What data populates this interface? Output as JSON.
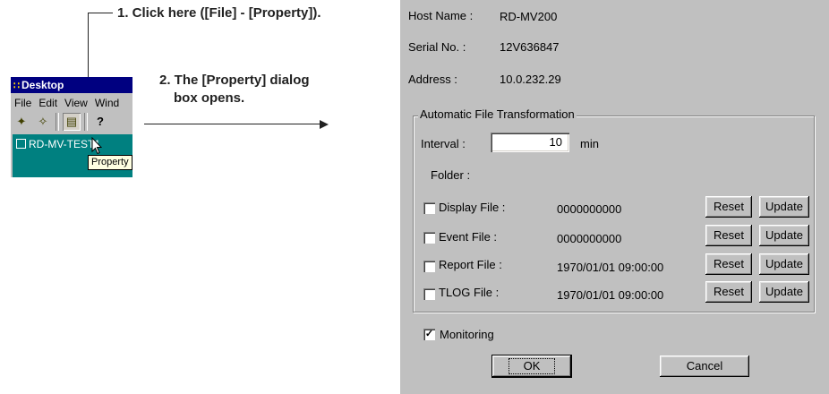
{
  "annotations": {
    "step1": "1. Click here ([File] - [Property]).",
    "step2_line1": "2. The [Property] dialog",
    "step2_line2": "box opens."
  },
  "mini_window": {
    "title": "Desktop",
    "menu": [
      "File",
      "Edit",
      "View",
      "Wind"
    ],
    "toolbar_icons": [
      "new-icon",
      "open-icon",
      "property-icon",
      "help-icon"
    ],
    "tree_item": "RD-MV-TEST1",
    "tooltip": "Property"
  },
  "dialog": {
    "host_name_label": "Host Name :",
    "host_name_value": "RD-MV200",
    "serial_label": "Serial No. :",
    "serial_value": "12V636847",
    "address_label": "Address :",
    "address_value": "10.0.232.29",
    "group_title": "Automatic File Transformation",
    "interval_label": "Interval :",
    "interval_value": "10",
    "interval_unit": "min",
    "folder_label": "Folder :",
    "files": [
      {
        "label": "Display File :",
        "value": "0000000000",
        "checked": false
      },
      {
        "label": "Event File :",
        "value": "0000000000",
        "checked": false
      },
      {
        "label": "Report File :",
        "value": "1970/01/01 09:00:00",
        "checked": false
      },
      {
        "label": "TLOG File :",
        "value": "1970/01/01 09:00:00",
        "checked": false
      }
    ],
    "reset_label": "Reset",
    "update_label": "Update",
    "monitoring_label": "Monitoring",
    "monitoring_checked": true,
    "ok_label": "OK",
    "cancel_label": "Cancel"
  }
}
